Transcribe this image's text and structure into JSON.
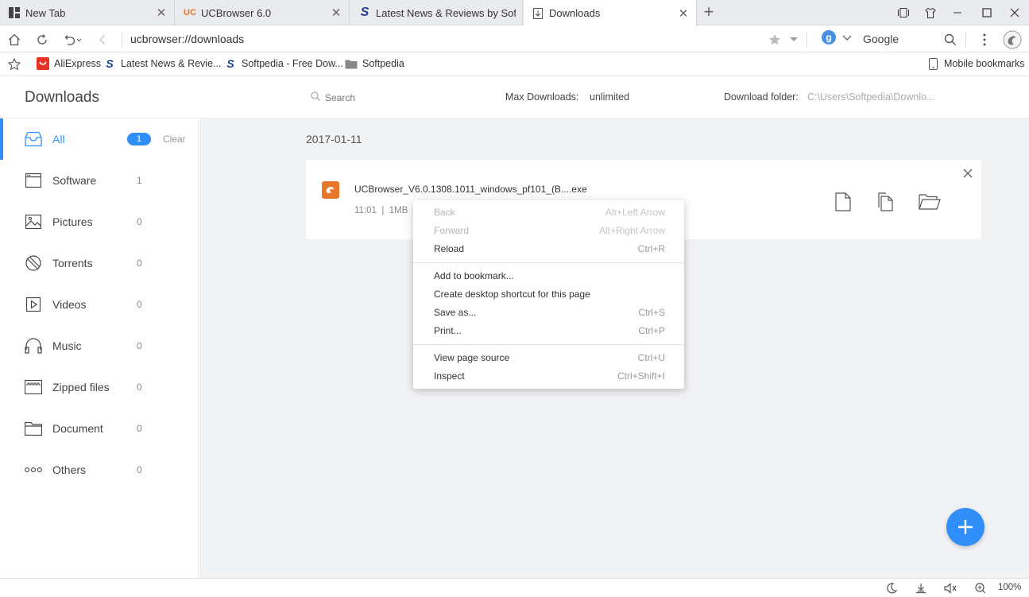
{
  "tabs": [
    {
      "title": "New Tab",
      "icon": "grid-icon"
    },
    {
      "title": "UCBrowser 6.0",
      "icon": "uc-icon",
      "icon_text": "UC"
    },
    {
      "title": "Latest News & Reviews by Softpedia",
      "icon": "softpedia-icon",
      "icon_text": "S"
    },
    {
      "title": "Downloads",
      "icon": "download-icon",
      "active": true
    }
  ],
  "toolbar": {
    "url": "ucbrowser://downloads",
    "search_engine_letter": "g",
    "search_engine": "Google"
  },
  "bookmarks": {
    "items": [
      {
        "label": "AliExpress",
        "icon": "aliexpress-icon"
      },
      {
        "label": "Latest News & Revie...",
        "icon": "softpedia-icon",
        "icon_text": "S"
      },
      {
        "label": "Softpedia - Free Dow...",
        "icon": "softpedia-icon",
        "icon_text": "S"
      },
      {
        "label": "Softpedia",
        "icon": "folder-icon"
      }
    ],
    "mobile": "Mobile bookmarks"
  },
  "header": {
    "title": "Downloads",
    "search_placeholder": "Search",
    "max_label": "Max Downloads:",
    "max_value": "unlimited",
    "folder_label": "Download folder:",
    "folder_value": "C:\\Users\\Softpedia\\Downlo..."
  },
  "sidebar": {
    "items": [
      {
        "label": "All",
        "count": "1",
        "icon": "inbox-icon",
        "active": true,
        "clear": "Clear"
      },
      {
        "label": "Software",
        "count": "1",
        "icon": "window-icon"
      },
      {
        "label": "Pictures",
        "count": "0",
        "icon": "picture-icon"
      },
      {
        "label": "Torrents",
        "count": "0",
        "icon": "torrent-icon"
      },
      {
        "label": "Videos",
        "count": "0",
        "icon": "video-icon"
      },
      {
        "label": "Music",
        "count": "0",
        "icon": "headphones-icon"
      },
      {
        "label": "Zipped files",
        "count": "0",
        "icon": "zip-icon"
      },
      {
        "label": "Document",
        "count": "0",
        "icon": "folder-icon"
      },
      {
        "label": "Others",
        "count": "0",
        "icon": "more-icon"
      }
    ]
  },
  "main": {
    "date": "2017-01-11",
    "download": {
      "name": "UCBrowser_V6.0.1308.1011_windows_pf101_(B....exe",
      "time": "11:01",
      "size": "1MB"
    }
  },
  "context_menu": {
    "items": [
      {
        "label": "Back",
        "key": "Alt+Left Arrow",
        "disabled": true
      },
      {
        "label": "Forward",
        "key": "Alt+Right Arrow",
        "disabled": true
      },
      {
        "label": "Reload",
        "key": "Ctrl+R"
      },
      {
        "label": "Add to bookmark...",
        "key": ""
      },
      {
        "label": "Create desktop shortcut for this page",
        "key": ""
      },
      {
        "label": "Save as...",
        "key": "Ctrl+S"
      },
      {
        "label": "Print...",
        "key": "Ctrl+P"
      },
      {
        "label": "View page source",
        "key": "Ctrl+U"
      },
      {
        "label": "Inspect",
        "key": "Ctrl+Shift+I"
      }
    ]
  },
  "statusbar": {
    "zoom": "100%"
  },
  "colors": {
    "accent": "#2f8ef7",
    "uc_orange": "#e8772e",
    "softpedia_blue": "#1a3d8f"
  }
}
